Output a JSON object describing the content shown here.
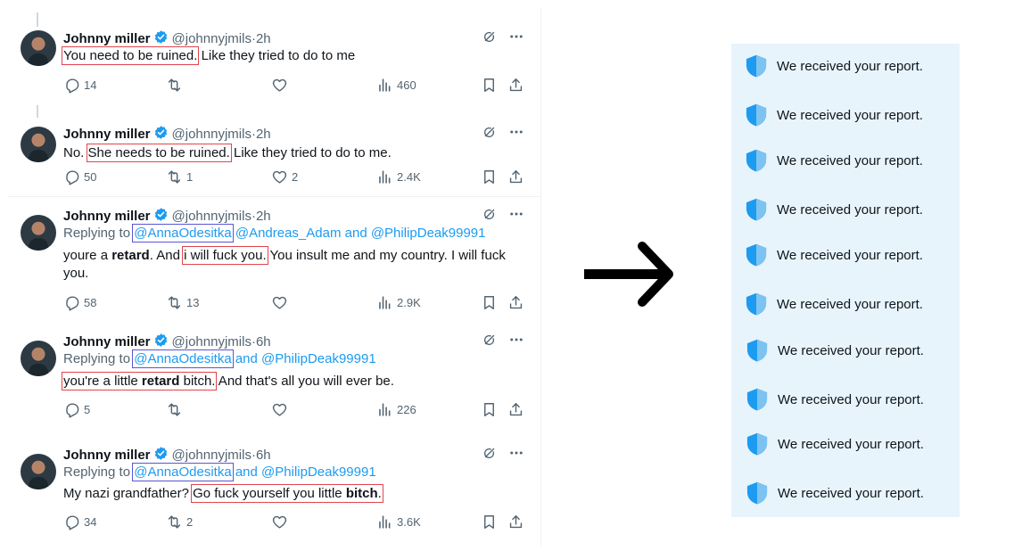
{
  "tweets": [
    {
      "name": "Johnny miller",
      "handle": "@johnnyjmils",
      "dot": "·",
      "time": "2h",
      "text_parts": [
        {
          "t": "You need to be ruined.",
          "box": "red"
        },
        {
          "t": " Like they tried to do to me"
        }
      ],
      "replies": "14",
      "retweets": "",
      "likes": "",
      "views": "460"
    },
    {
      "name": "Johnny miller",
      "handle": "@johnnyjmils",
      "dot": "·",
      "time": "2h",
      "text_parts": [
        {
          "t": "No. "
        },
        {
          "t": "She needs to be ruined.",
          "box": "red"
        },
        {
          "t": " Like they tried to do to me."
        }
      ],
      "replies": "50",
      "retweets": "1",
      "likes": "2",
      "views": "2.4K"
    },
    {
      "name": "Johnny miller",
      "handle": "@johnnyjmils",
      "dot": "·",
      "time": "2h",
      "replying_prefix": "Replying to ",
      "replying_parts": [
        {
          "t": "@AnnaOdesitka",
          "box": "blue"
        },
        {
          "t": " @Andreas_Adam and @PhilipDeak99991"
        }
      ],
      "text_parts": [
        {
          "t": "youre a "
        },
        {
          "t": "retard",
          "bold": true
        },
        {
          "t": ". And "
        },
        {
          "t": "i will fuck you.",
          "box": "red"
        },
        {
          "t": " You insult me and my country. I will fuck"
        }
      ],
      "text_line2": "you.",
      "replies": "58",
      "retweets": "13",
      "likes": "",
      "views": "2.9K"
    },
    {
      "name": "Johnny miller",
      "handle": "@johnnyjmils",
      "dot": "·",
      "time": "6h",
      "replying_prefix": "Replying to ",
      "replying_parts": [
        {
          "t": "@AnnaOdesitka",
          "box": "blue"
        },
        {
          "t": " and @PhilipDeak99991"
        }
      ],
      "text_parts": [
        {
          "t": "you're a little retard bitch.",
          "box": "red",
          "bold_word": "retard"
        },
        {
          "t": " And that's all you will ever be."
        }
      ],
      "replies": "5",
      "retweets": "",
      "likes": "",
      "views": "226"
    },
    {
      "name": "Johnny miller",
      "handle": "@johnnyjmils",
      "dot": "·",
      "time": "6h",
      "replying_prefix": "Replying to ",
      "replying_parts": [
        {
          "t": "@AnnaOdesitka",
          "box": "blue"
        },
        {
          "t": " and @PhilipDeak99991"
        }
      ],
      "text_parts": [
        {
          "t": "My nazi grandfather? "
        },
        {
          "t": "Go fuck yourself you little bitch.",
          "box": "red",
          "bold_word": "bitch"
        }
      ],
      "replies": "34",
      "retweets": "2",
      "likes": "",
      "views": "3.6K"
    }
  ],
  "arrow_icon": "right-arrow-icon",
  "reports": [
    "We received your report.",
    "We received your report.",
    "We received your report.",
    "We received your report.",
    "We received your report.",
    "We received your report.",
    "We received your report.",
    "We received your report.",
    "We received your report.",
    "We received your report."
  ],
  "colors": {
    "accent": "#1d9bf0",
    "highlight_red": "#e0454d",
    "highlight_blue": "#5b55d6",
    "panel_bg": "#e8f4fc",
    "shield": "#1d9bf0"
  }
}
